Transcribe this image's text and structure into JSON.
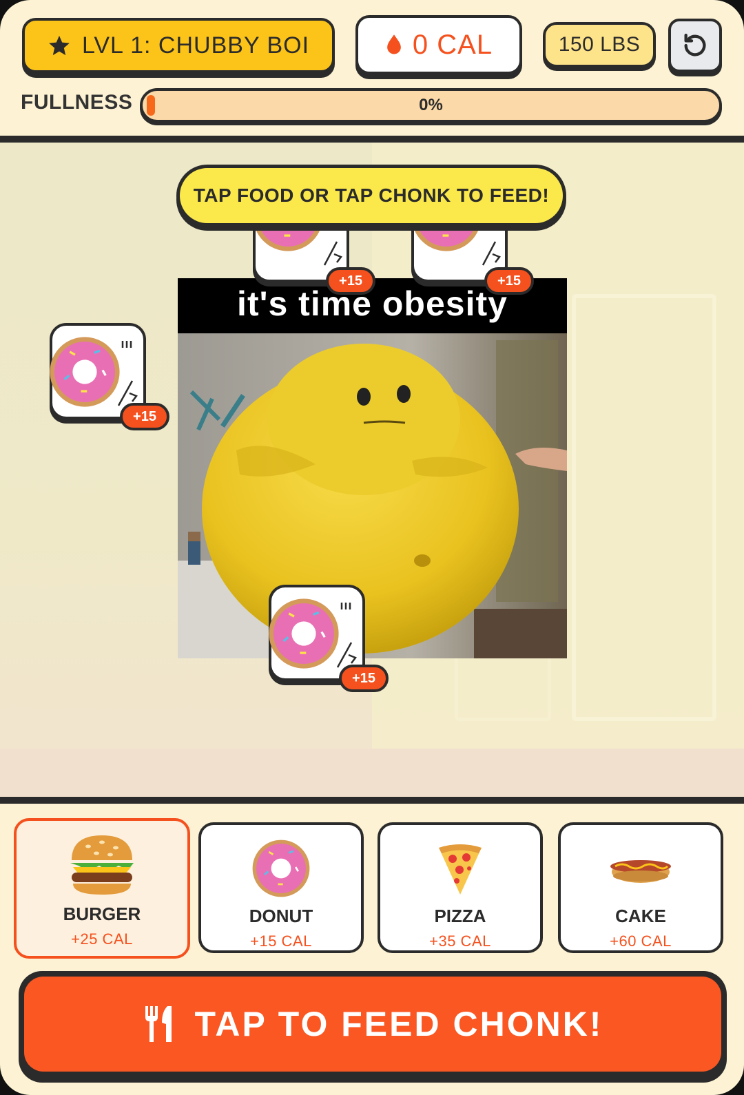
{
  "header": {
    "level_label": "LVL 1: CHUBBY BOI",
    "calories_label": "0 CAL",
    "weight_label": "150 LBS",
    "fullness_label": "FULLNESS",
    "fullness_percent_text": "0%",
    "fullness_value": 0
  },
  "scene": {
    "hint_text": "TAP FOOD OR TAP CHONK TO FEED!",
    "meme_caption": "it's time obesity",
    "floating_foods": [
      {
        "label": "+15",
        "icon": "donut-icon"
      },
      {
        "label": "+15",
        "icon": "donut-icon"
      },
      {
        "label": "+15",
        "icon": "donut-icon"
      },
      {
        "label": "+15",
        "icon": "donut-icon"
      }
    ]
  },
  "foods": [
    {
      "name": "BURGER",
      "cal": "+25 CAL",
      "icon": "burger-icon",
      "selected": true
    },
    {
      "name": "DONUT",
      "cal": "+15 CAL",
      "icon": "donut-icon",
      "selected": false
    },
    {
      "name": "PIZZA",
      "cal": "+35 CAL",
      "icon": "pizza-icon",
      "selected": false
    },
    {
      "name": "CAKE",
      "cal": "+60 CAL",
      "icon": "hotdog-icon",
      "selected": false
    }
  ],
  "feed_button_label": "TAP TO FEED CHONK!",
  "colors": {
    "accent_orange": "#fa5722",
    "level_yellow": "#fcc419",
    "hint_yellow": "#fbe94b",
    "background_cream": "#fdf3d4",
    "outline": "#2b2b2b"
  }
}
